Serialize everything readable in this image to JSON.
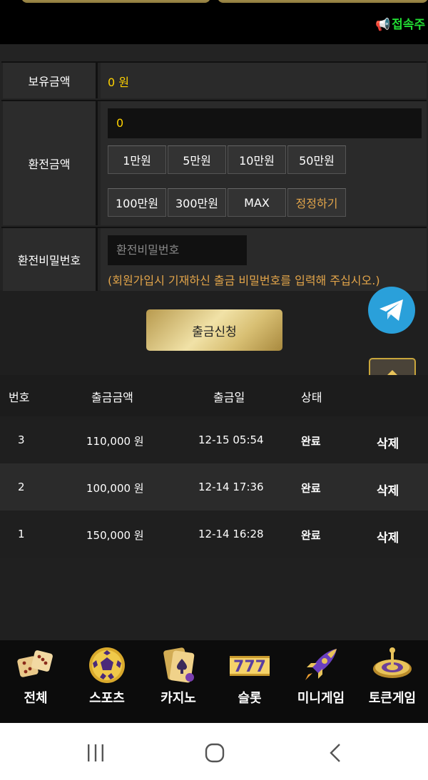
{
  "marquee": {
    "text": "접속주"
  },
  "balance": {
    "label": "보유금액",
    "value": "0 원"
  },
  "exchange": {
    "label": "환전금액",
    "amount_value": "0",
    "quick_buttons": [
      "1만원",
      "5만원",
      "10만원",
      "50만원",
      "100만원",
      "300만원",
      "MAX",
      "정정하기"
    ]
  },
  "password": {
    "label": "환전비밀번호",
    "placeholder": "환전비밀번호",
    "note": "(회원가입시 기재하신 출금 비밀번호를 입력해 주십시오.)"
  },
  "submit_label": "출금신청",
  "table": {
    "headers": [
      "번호",
      "출금금액",
      "출금일",
      "상태"
    ],
    "rows": [
      {
        "no": "3",
        "amount": "110,000 원",
        "date": "12-15 05:54",
        "status": "완료",
        "action": "삭제"
      },
      {
        "no": "2",
        "amount": "100,000 원",
        "date": "12-14 17:36",
        "status": "완료",
        "action": "삭제"
      },
      {
        "no": "1",
        "amount": "150,000 원",
        "date": "12-14 16:28",
        "status": "완료",
        "action": "삭제"
      }
    ]
  },
  "bottom_nav": [
    {
      "label": "전체",
      "icon": "dice-icon"
    },
    {
      "label": "스포츠",
      "icon": "soccer-ball-icon"
    },
    {
      "label": "카지노",
      "icon": "playing-cards-icon"
    },
    {
      "label": "슬롯",
      "icon": "slot-777-icon"
    },
    {
      "label": "미니게임",
      "icon": "rocket-icon"
    },
    {
      "label": "토큰게임",
      "icon": "roulette-icon"
    }
  ],
  "colors": {
    "accent_gold": "#ffd200",
    "note_orange": "#e3a54a",
    "telegram_blue": "#2aa0da"
  }
}
